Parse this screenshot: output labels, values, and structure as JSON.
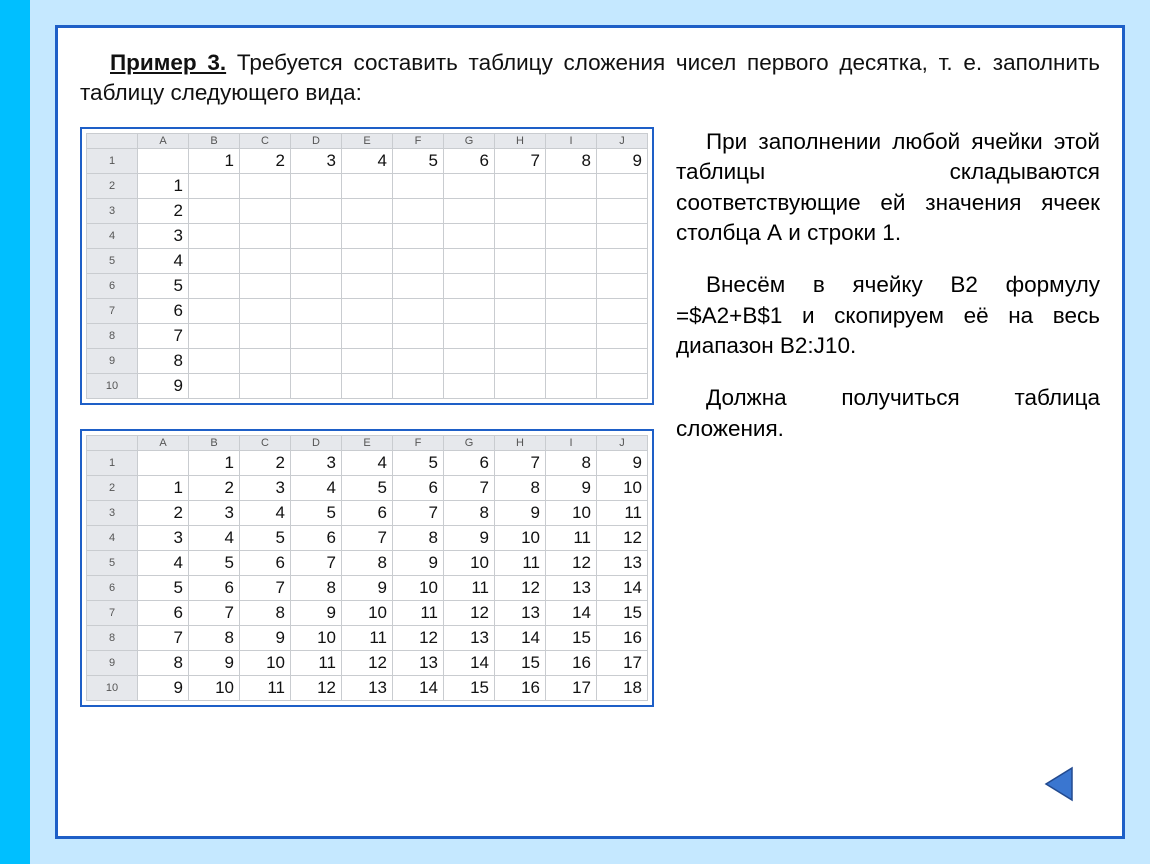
{
  "intro": {
    "title": "Пример 3.",
    "rest": "Требуется составить таблицу сложения чисел первого десятка, т. е. заполнить таблицу следующего вида:"
  },
  "right": {
    "p1": "При заполнении любой ячейки этой таблицы складываются соответствующие ей значения ячеек столбца А и строки 1.",
    "p2": "Внесём в ячейку В2 формулу =$A2+B$1 и скопируем её на весь диапазон В2:J10.",
    "p3": "Должна получиться таблица сложения."
  },
  "sheet_cols": [
    "A",
    "B",
    "C",
    "D",
    "E",
    "F",
    "G",
    "H",
    "I",
    "J"
  ],
  "sheet_row_headers": [
    "1",
    "2",
    "3",
    "4",
    "5",
    "6",
    "7",
    "8",
    "9",
    "10"
  ],
  "table1": [
    [
      "",
      "1",
      "2",
      "3",
      "4",
      "5",
      "6",
      "7",
      "8",
      "9"
    ],
    [
      "1",
      "",
      "",
      "",
      "",
      "",
      "",
      "",
      "",
      ""
    ],
    [
      "2",
      "",
      "",
      "",
      "",
      "",
      "",
      "",
      "",
      ""
    ],
    [
      "3",
      "",
      "",
      "",
      "",
      "",
      "",
      "",
      "",
      ""
    ],
    [
      "4",
      "",
      "",
      "",
      "",
      "",
      "",
      "",
      "",
      ""
    ],
    [
      "5",
      "",
      "",
      "",
      "",
      "",
      "",
      "",
      "",
      ""
    ],
    [
      "6",
      "",
      "",
      "",
      "",
      "",
      "",
      "",
      "",
      ""
    ],
    [
      "7",
      "",
      "",
      "",
      "",
      "",
      "",
      "",
      "",
      ""
    ],
    [
      "8",
      "",
      "",
      "",
      "",
      "",
      "",
      "",
      "",
      ""
    ],
    [
      "9",
      "",
      "",
      "",
      "",
      "",
      "",
      "",
      "",
      ""
    ]
  ],
  "table2": [
    [
      "",
      "1",
      "2",
      "3",
      "4",
      "5",
      "6",
      "7",
      "8",
      "9"
    ],
    [
      "1",
      "2",
      "3",
      "4",
      "5",
      "6",
      "7",
      "8",
      "9",
      "10"
    ],
    [
      "2",
      "3",
      "4",
      "5",
      "6",
      "7",
      "8",
      "9",
      "10",
      "11"
    ],
    [
      "3",
      "4",
      "5",
      "6",
      "7",
      "8",
      "9",
      "10",
      "11",
      "12"
    ],
    [
      "4",
      "5",
      "6",
      "7",
      "8",
      "9",
      "10",
      "11",
      "12",
      "13"
    ],
    [
      "5",
      "6",
      "7",
      "8",
      "9",
      "10",
      "11",
      "12",
      "13",
      "14"
    ],
    [
      "6",
      "7",
      "8",
      "9",
      "10",
      "11",
      "12",
      "13",
      "14",
      "15"
    ],
    [
      "7",
      "8",
      "9",
      "10",
      "11",
      "12",
      "13",
      "14",
      "15",
      "16"
    ],
    [
      "8",
      "9",
      "10",
      "11",
      "12",
      "13",
      "14",
      "15",
      "16",
      "17"
    ],
    [
      "9",
      "10",
      "11",
      "12",
      "13",
      "14",
      "15",
      "16",
      "17",
      "18"
    ]
  ],
  "nav": {
    "prev_icon": "triangle-left-icon"
  }
}
